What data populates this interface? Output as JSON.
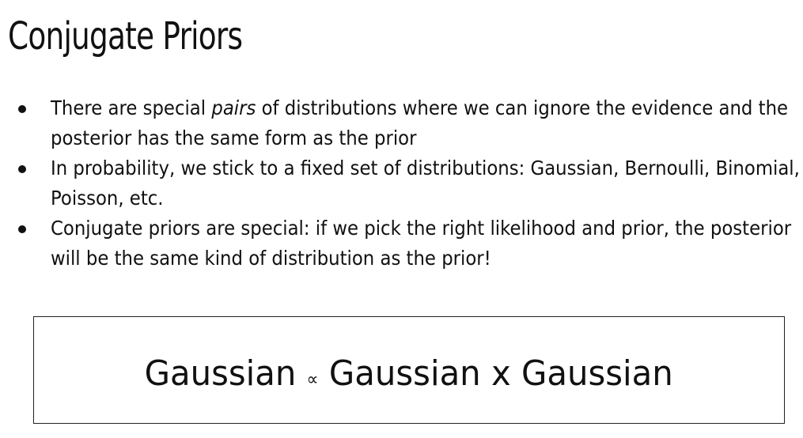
{
  "title": "Conjugate Priors",
  "bullets": [
    {
      "before": "There are special ",
      "emphasis": "pairs",
      "after": " of distributions where we can ignore the evidence and the posterior has the same form as the prior"
    },
    {
      "before": "In probability, we stick to a fixed set of distributions: Gaussian, Bernoulli, Binomial, Poisson, etc.",
      "emphasis": "",
      "after": ""
    },
    {
      "before": "Conjugate priors are special: if we pick the right likelihood and prior, the posterior will be the same kind of distribution as the prior!",
      "emphasis": "",
      "after": ""
    }
  ],
  "formula": {
    "posterior": "Gaussian",
    "relation_symbol": "∝",
    "likelihood_times_prior": "Gaussian x Gaussian"
  }
}
